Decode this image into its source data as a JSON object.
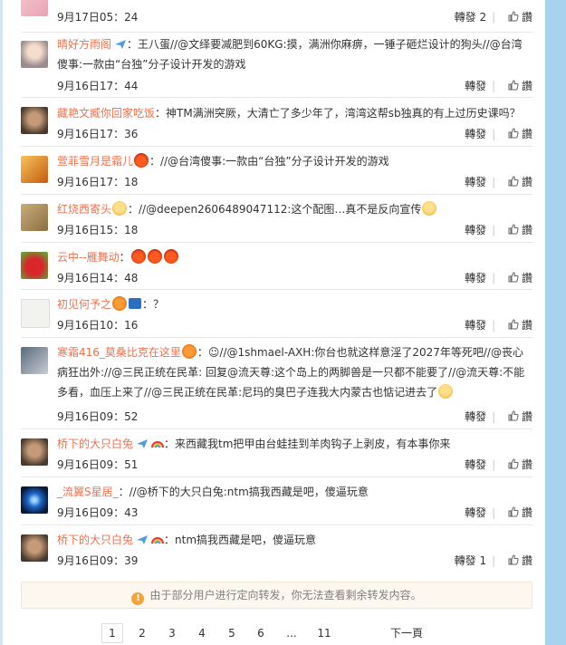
{
  "comments": [
    {
      "user": "",
      "text": "",
      "time": "9月17日05：24",
      "repost": "轉發 2",
      "like": "讚"
    },
    {
      "user": "晴好方雨阁",
      "text": "：王八蛋//@文绎要减肥到60KG:摸，满洲你麻痹，一锤子砸烂设计的狗头//@台湾傻事:一款由“台独”分子设计开发的游戏",
      "time": "9月16日17：44",
      "repost": "轉發",
      "like": "讚"
    },
    {
      "user": "藏艳文臧你回家吃饭",
      "text": "：神TM满洲突厥，大清亡了多少年了，湾湾这帮sb独真的有上过历史课吗？",
      "time": "9月16日17：36",
      "repost": "轉發",
      "like": "讚"
    },
    {
      "user": "萱菲雪月是霜儿",
      "text": "：//@台湾傻事:一款由“台独”分子设计开发的游戏",
      "time": "9月16日17：18",
      "repost": "轉發",
      "like": "讚"
    },
    {
      "user": "红烧西寄头",
      "text": "：//@deepen2606489047112:这个配图…真不是反向宣传",
      "time": "9月16日15：18",
      "repost": "轉發",
      "like": "讚"
    },
    {
      "user": "云中--雁舞动",
      "text": "：",
      "time": "9月16日14：48",
      "repost": "轉發",
      "like": "讚"
    },
    {
      "user": "初见何予之",
      "text": "：？",
      "time": "9月16日10：16",
      "repost": "轉發",
      "like": "讚"
    },
    {
      "user": "寒霜416_莫桑比克在这里",
      "text": "：☺//@1shmael-AXH:你台也就这样意淫了2027年等死吧//@丧心病狂出外://@三民正统在民革: 回复@流天尊:这个岛上的两脚兽是一只都不能要了//@流天尊:不能多看，血压上来了//@三民正统在民革:尼玛的臭巴子连我大内蒙古也惦记进去了",
      "time": "9月16日09：52",
      "repost": "轉發",
      "like": "讚"
    },
    {
      "user": "桥下的大只白兔",
      "text": "：来西藏我tm把甲由台蛙挂到羊肉钩子上剥皮，有本事你来",
      "time": "9月16日09：51",
      "repost": "轉發",
      "like": "讚"
    },
    {
      "user": "_流翼S星居_",
      "text": "：//@桥下的大只白兔:ntm搞我西藏是吧，傻逼玩意",
      "time": "9月16日09：43",
      "repost": "轉發",
      "like": "讚"
    },
    {
      "user": "桥下的大只白兔",
      "text": "：ntm搞我西藏是吧，傻逼玩意",
      "time": "9月16日09：39",
      "repost": "轉發 1",
      "like": "讚"
    }
  ],
  "notice": {
    "text": "由于部分用户进行定向转发，你无法查看剩余转发内容。",
    "icon": "warning-icon"
  },
  "pagination": {
    "pages": [
      "1",
      "2",
      "3",
      "4",
      "5",
      "6",
      "...",
      "11"
    ],
    "current": "1",
    "next": "下一頁"
  },
  "colors": {
    "username": "#eb7350",
    "mention": "#4f80b4",
    "sidebar": "#a9d2ef"
  }
}
